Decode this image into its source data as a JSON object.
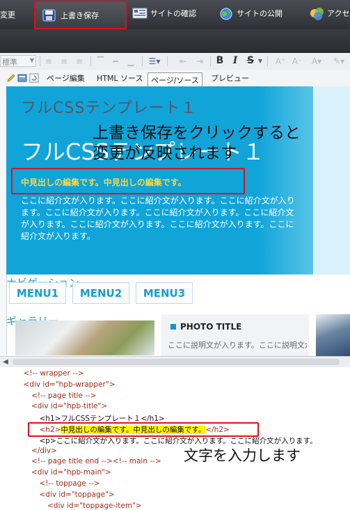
{
  "toolbar": {
    "change_label": "変更",
    "save_label": "上書き保存",
    "check_label": "サイトの確認",
    "publish_label": "サイトの公開",
    "access_label": "アクセス"
  },
  "format_bar": {
    "style_value": "標準",
    "bold": "B",
    "italic": "I",
    "strike": "S"
  },
  "tabs": [
    {
      "label": "ページ編集"
    },
    {
      "label": "HTML ソース"
    },
    {
      "label": "ページ/ソース"
    },
    {
      "label": "プレビュー"
    }
  ],
  "preview": {
    "h1": "フルCSSテンプレート１",
    "h1_large": "フルCSSテンプレート１",
    "overlay_line1": "上書き保存をクリックすると",
    "overlay_line2": "変更が反映されます",
    "h2": "中見出しの編集です。中見出しの編集です。",
    "intro_lines": [
      "ここに紹介文が入ります。ここに紹介文が入ります。ここに紹介文が入り",
      "ます。ここに紹介文が入ります。ここに紹介文が入ります。ここに紹介文",
      "が入ります。ここに紹介文が入ります。ここに紹介文が入ります。ここに",
      "紹介文が入ります。"
    ],
    "nav_title": "ナビゲーション",
    "menus": [
      "MENU1",
      "MENU2",
      "MENU3"
    ],
    "gallery_title": "ギャラリー",
    "photo_title": "PHOTO TITLE",
    "photo_desc": "ここに説明文が入ります。ここに説明文が入ります。"
  },
  "code": {
    "lines": [
      {
        "indent": 1,
        "text": "<!-- wrapper -->",
        "kind": "comment"
      },
      {
        "indent": 1,
        "text": "<div id=\"hpb-wrapper\">",
        "kind": "tag"
      },
      {
        "indent": 2,
        "text": "<!-- page title -->",
        "kind": "comment"
      },
      {
        "indent": 2,
        "text": "<div id=\"hpb-title\">",
        "kind": "tag"
      },
      {
        "indent": 3,
        "text": "<h1>フルCSSテンプレート１</h1>",
        "kind": "text"
      },
      {
        "indent": 3,
        "pre": "<h2>",
        "hl": "中見出しの編集です。中見出しの編集です。",
        "post": "</h2>",
        "kind": "highlight"
      },
      {
        "indent": 3,
        "text": "<p>ここに紹介文が入ります。ここに紹介文が入ります。ここに紹介文が入ります。",
        "kind": "text"
      },
      {
        "indent": 2,
        "text": "</div>",
        "kind": "tag"
      },
      {
        "indent": 2,
        "text": "<!-- page title end --><!-- main -->",
        "kind": "comment"
      },
      {
        "indent": 2,
        "text": "<div id=\"hpb-main\">",
        "kind": "tag"
      },
      {
        "indent": 3,
        "text": "<!-- toppage -->",
        "kind": "comment"
      },
      {
        "indent": 3,
        "text": "<div id=\"toppage\">",
        "kind": "tag"
      },
      {
        "indent": 4,
        "text": "<div id=\"toppage-item\">",
        "kind": "tag"
      }
    ],
    "annotation": "文字を入力します"
  },
  "colors": {
    "accent": "#10a4d9",
    "highlight_box": "#e0101a",
    "heading_yellow": "#f6d84a",
    "code_tag": "#a12c18"
  }
}
